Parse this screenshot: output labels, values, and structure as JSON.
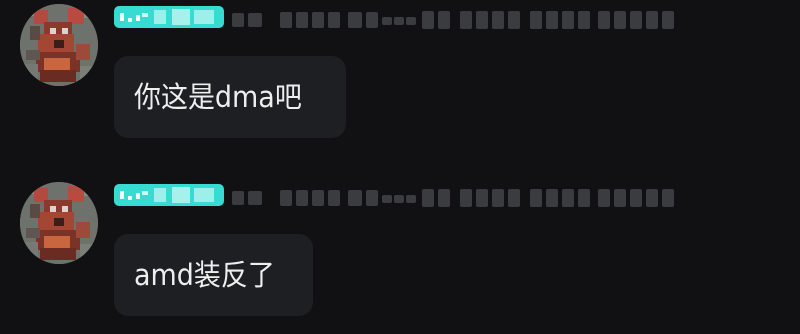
{
  "messages": [
    {
      "text": "你这是dma吧",
      "avatar_icon": "cartoon-mouse-avatar-icon",
      "tag_color": "#36dcd2"
    },
    {
      "text": "amd装反了",
      "avatar_icon": "cartoon-mouse-avatar-icon",
      "tag_color": "#36dcd2"
    }
  ],
  "colors": {
    "background": "#111113",
    "bubble": "#1e1f22",
    "text": "#eeeeee",
    "tag": "#36dcd2"
  }
}
